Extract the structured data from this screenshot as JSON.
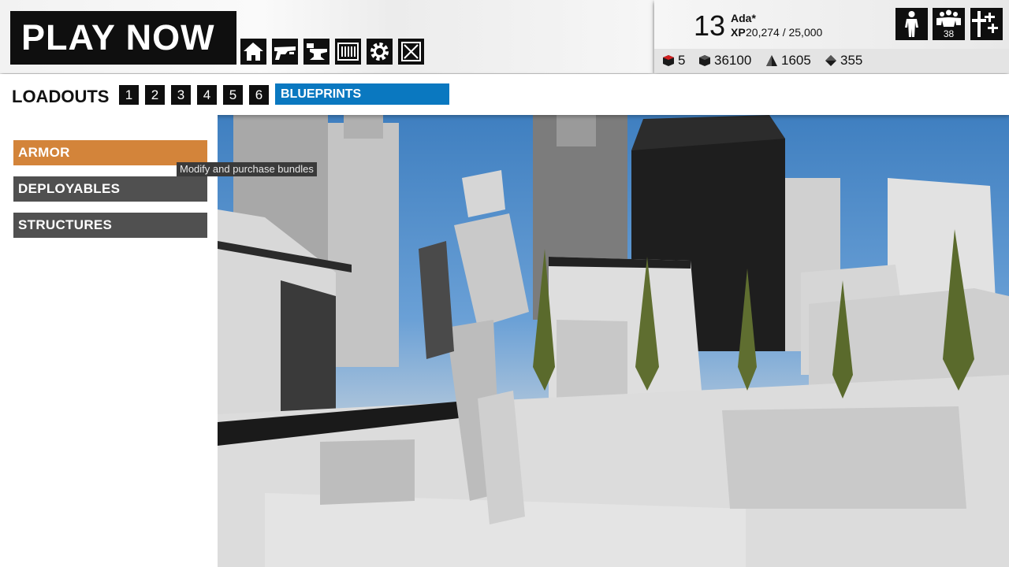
{
  "header": {
    "play_now": "PLAY NOW",
    "nav_icons": [
      "home-icon",
      "weapon-icon",
      "anvil-icon",
      "barcode-icon",
      "gear-icon",
      "close-box-icon"
    ]
  },
  "player": {
    "level": "13",
    "name": "Ada*",
    "xp_label": "XP",
    "xp_value": "20,274 / 25,000",
    "squad_count": "38",
    "currencies": [
      {
        "icon": "red-cube-icon",
        "value": "5",
        "color": "#d21f1f"
      },
      {
        "icon": "cube-icon",
        "value": "36100"
      },
      {
        "icon": "pyramid-icon",
        "value": "1605"
      },
      {
        "icon": "diamond-icon",
        "value": "355"
      }
    ]
  },
  "loadouts": {
    "title": "LOADOUTS",
    "slots": [
      "1",
      "2",
      "3",
      "4",
      "5",
      "6"
    ],
    "blueprints": "BLUEPRINTS"
  },
  "menu": {
    "items": [
      {
        "label": "ARMOR",
        "active": true,
        "color": "#d3843a"
      },
      {
        "label": "DEPLOYABLES",
        "active": false
      },
      {
        "label": "STRUCTURES",
        "active": false
      }
    ],
    "tooltip": "Modify and purchase bundles"
  },
  "colors": {
    "accent_blue": "#0a78c0",
    "accent_orange": "#d3843a",
    "button_dark": "#0f0f0f",
    "menu_gray": "#505050"
  }
}
